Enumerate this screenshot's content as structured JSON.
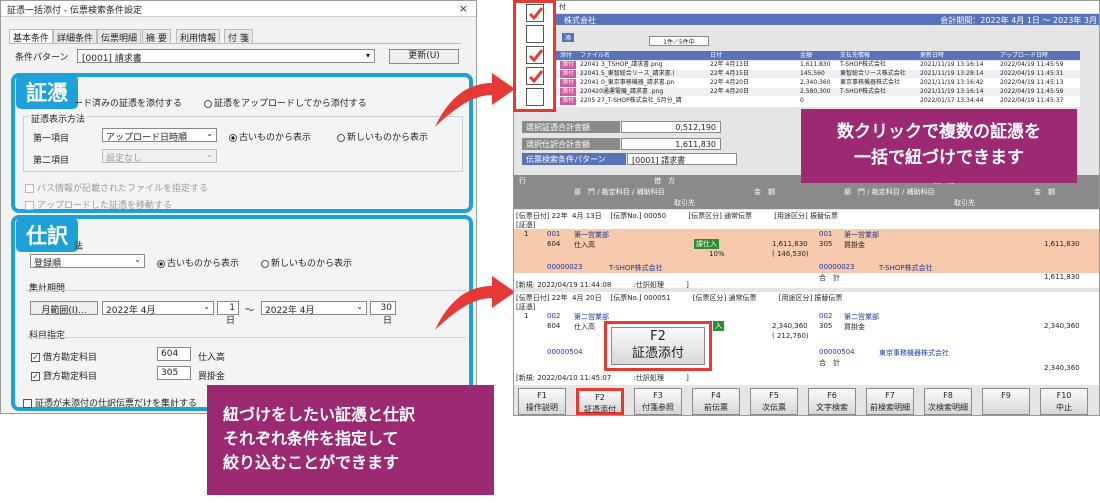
{
  "dialog": {
    "title": "証憑一括添付 - 伝票検索条件設定",
    "close": "×",
    "tabs": [
      "基本条件",
      "詳細条件",
      "伝票明細",
      "摘 要",
      "利用情報",
      "付 箋"
    ],
    "pattern_label": "条件パターン",
    "pattern_value": "[0001] 請求書",
    "update_button": "更新(U)",
    "voucher_section": {
      "badge": "証憑",
      "option_a": "ード済みの証憑を添付する",
      "option_b": "証憑をアップロードしてから添付する",
      "display_group": "証憑表示方法",
      "first_item_label": "第一項目",
      "first_item_value": "アップロード日時順",
      "order_old": "古いものから表示",
      "order_new": "新しいものから表示",
      "second_item_label": "第二項目",
      "second_item_value": "設定なし",
      "check_path": "パス情報が記載されたファイルを指定する",
      "check_move": "アップロードした証憑を移動する"
    },
    "journal_section": {
      "badge": "仕訳",
      "label_fragment": "法",
      "method_value": "登録順",
      "order_old": "古いものから表示",
      "order_new": "新しいものから表示",
      "period_group": "集計期間",
      "period_unit": "月範囲(I)...",
      "from_month": "2022年  4月",
      "from_day": "1日",
      "tilde": "～",
      "to_month": "2022年  4月",
      "to_day": "30日",
      "account_group": "科目指定",
      "debit_label": "借方勘定科目",
      "debit_code": "604",
      "debit_name": "仕入高",
      "credit_label": "貸方勘定科目",
      "credit_code": "305",
      "credit_name": "買掛金",
      "check_unattached": "証憑が未添付の仕訳伝票だけを集計する"
    }
  },
  "callouts": {
    "left": "紐づけをしたい証憑と仕訳\nそれぞれ条件を指定して\n絞り込むことができます",
    "right": "数クリックで複数の証憑を\n一括で紐づけできます"
  },
  "app": {
    "title_fragment": "付",
    "company": "株式会社",
    "fiscal_period": "会計期間：2022年  4月  1日 ～ 2023年  3月",
    "upload_label": "添",
    "count": "1件／5件中",
    "grid_headers": [
      "添付",
      "ファイル名",
      "日付",
      "金額",
      "支払先情報",
      "更新日時",
      "アップロード日時"
    ],
    "grid_rows": [
      [
        "添付",
        "22041 3_TSHOP_請求書.png",
        "22年  4月13日",
        "1,611,830",
        "T-SHOP株式会社",
        "2021/11/19 13:16:14",
        "2022/04/19 11:45:59"
      ],
      [
        "添付",
        "22041 5_東智総合リース_請求書.(",
        "22年  4月15日",
        "145,560",
        "東智総合リース株式会社",
        "2021/11/19 13:28:14",
        "2022/04/19 11:45:31"
      ],
      [
        "添付",
        "22041 0_東京事務機器_請求書.pn",
        "22年  4月20日",
        "2,340,360",
        "東京事務機器株式会社",
        "2021/11/19 13:16:42",
        "2022/04/19 11:45:13"
      ],
      [
        "添付",
        "220420通運電機_請求書       .png",
        "22年  4月20日",
        "2,580,300",
        "T-SHOP株式会社",
        "2021/11/19 13:16:14",
        "2022/04/19 11:45:59"
      ],
      [
        "添付",
        "2205 27_T-SHOP株式会社_5月分_請",
        "",
        "0",
        "",
        "2022/01/17 13:34:44",
        "2022/04/19 11:45:37"
      ]
    ],
    "total_selected_label": "選択証憑合計金額",
    "total_selected_value": "0,512,190",
    "total_journal_label": "選択仕訳合計金額",
    "total_journal_value": "1,611,830",
    "condition_label": "伝票検索条件パターン",
    "condition_value": "[0001] 請求書",
    "journal_header": {
      "row": "行",
      "debit": "借　方",
      "credit": "貸　方",
      "dept_debit": "部　門 / 勘定科目 / 補助科目",
      "amount": "金　額",
      "dept_credit": "部　門 / 勘定科目 / 補助科目",
      "amount2": "金　額",
      "partner": "取引先",
      "partner2": "取引先"
    },
    "entry1": {
      "head": "[伝票日付] 22年  4月 13日    [伝票No.] 00050          [伝票区分] 通常伝票          [用途区分] 振替伝票",
      "tag": "[証憑]",
      "line": "1",
      "d_code1": "001",
      "d_name1": "第一営業部",
      "d_code2": "604",
      "d_name2": "仕入高",
      "d_tax": "課仕入",
      "d_rate": "10%",
      "d_amount": "1,611,830",
      "d_tax_amount": "( 146,530)",
      "c_code1": "001",
      "c_name1": "第一営業部",
      "c_code2": "305",
      "c_name2": "買掛金",
      "c_amount": "1,611,830",
      "d_partner_code": "00000023",
      "d_partner": "T-SHOP株式会社",
      "c_partner_code": "00000023",
      "c_partner": "T-SHOP株式会社",
      "total_label": "合　計",
      "total": "1,611,830",
      "footer": "[新規: 2022/04/19 11:44:08          :仕訳処理          ]"
    },
    "entry2": {
      "head": "[伝票日付] 22年  4月 20日    [伝票No.] 000051          [伝票区分] 通常伝票          [用途区分] 振替伝票",
      "tag": "[証憑]",
      "line": "1",
      "d_code1": "002",
      "d_name1": "第二営業部",
      "d_code2": "604",
      "d_name2": "仕入高",
      "d_tax": "入",
      "d_amount": "2,340,360",
      "d_tax_amount": "( 212,760)",
      "c_code1": "002",
      "c_name1": "第二営業部",
      "c_code2": "305",
      "c_name2": "買掛金",
      "c_amount": "2,340,360",
      "d_partner_code": "00000504",
      "c_partner_code": "00000504",
      "c_partner": "東京事務機器株式会社",
      "total_label": "合　計",
      "total": "2,340,360",
      "footer": "[新規: 2022/04/10 11:45:07          :仕訳処理          ]"
    },
    "f2_popup": {
      "key": "F2",
      "label": "証憑添付"
    },
    "function_keys": [
      {
        "key": "F1",
        "label": "操作説明"
      },
      {
        "key": "F2",
        "label": "証憑添付"
      },
      {
        "key": "F3",
        "label": "付箋参照"
      },
      {
        "key": "F4",
        "label": "前伝票"
      },
      {
        "key": "F5",
        "label": "次伝票"
      },
      {
        "key": "F6",
        "label": "文字検索"
      },
      {
        "key": "F7",
        "label": "前検索明細"
      },
      {
        "key": "F8",
        "label": "次検索明細"
      },
      {
        "key": "F9",
        "label": ""
      },
      {
        "key": "F10",
        "label": "中止"
      }
    ],
    "checks": [
      true,
      false,
      true,
      true,
      false
    ]
  },
  "colors": {
    "accent_blue": "#1ea0d9",
    "callout_purple": "#9c2a72",
    "highlight_red": "#e53935",
    "entry_salmon": "#f7c9ad",
    "header_blue": "#5873b8"
  }
}
